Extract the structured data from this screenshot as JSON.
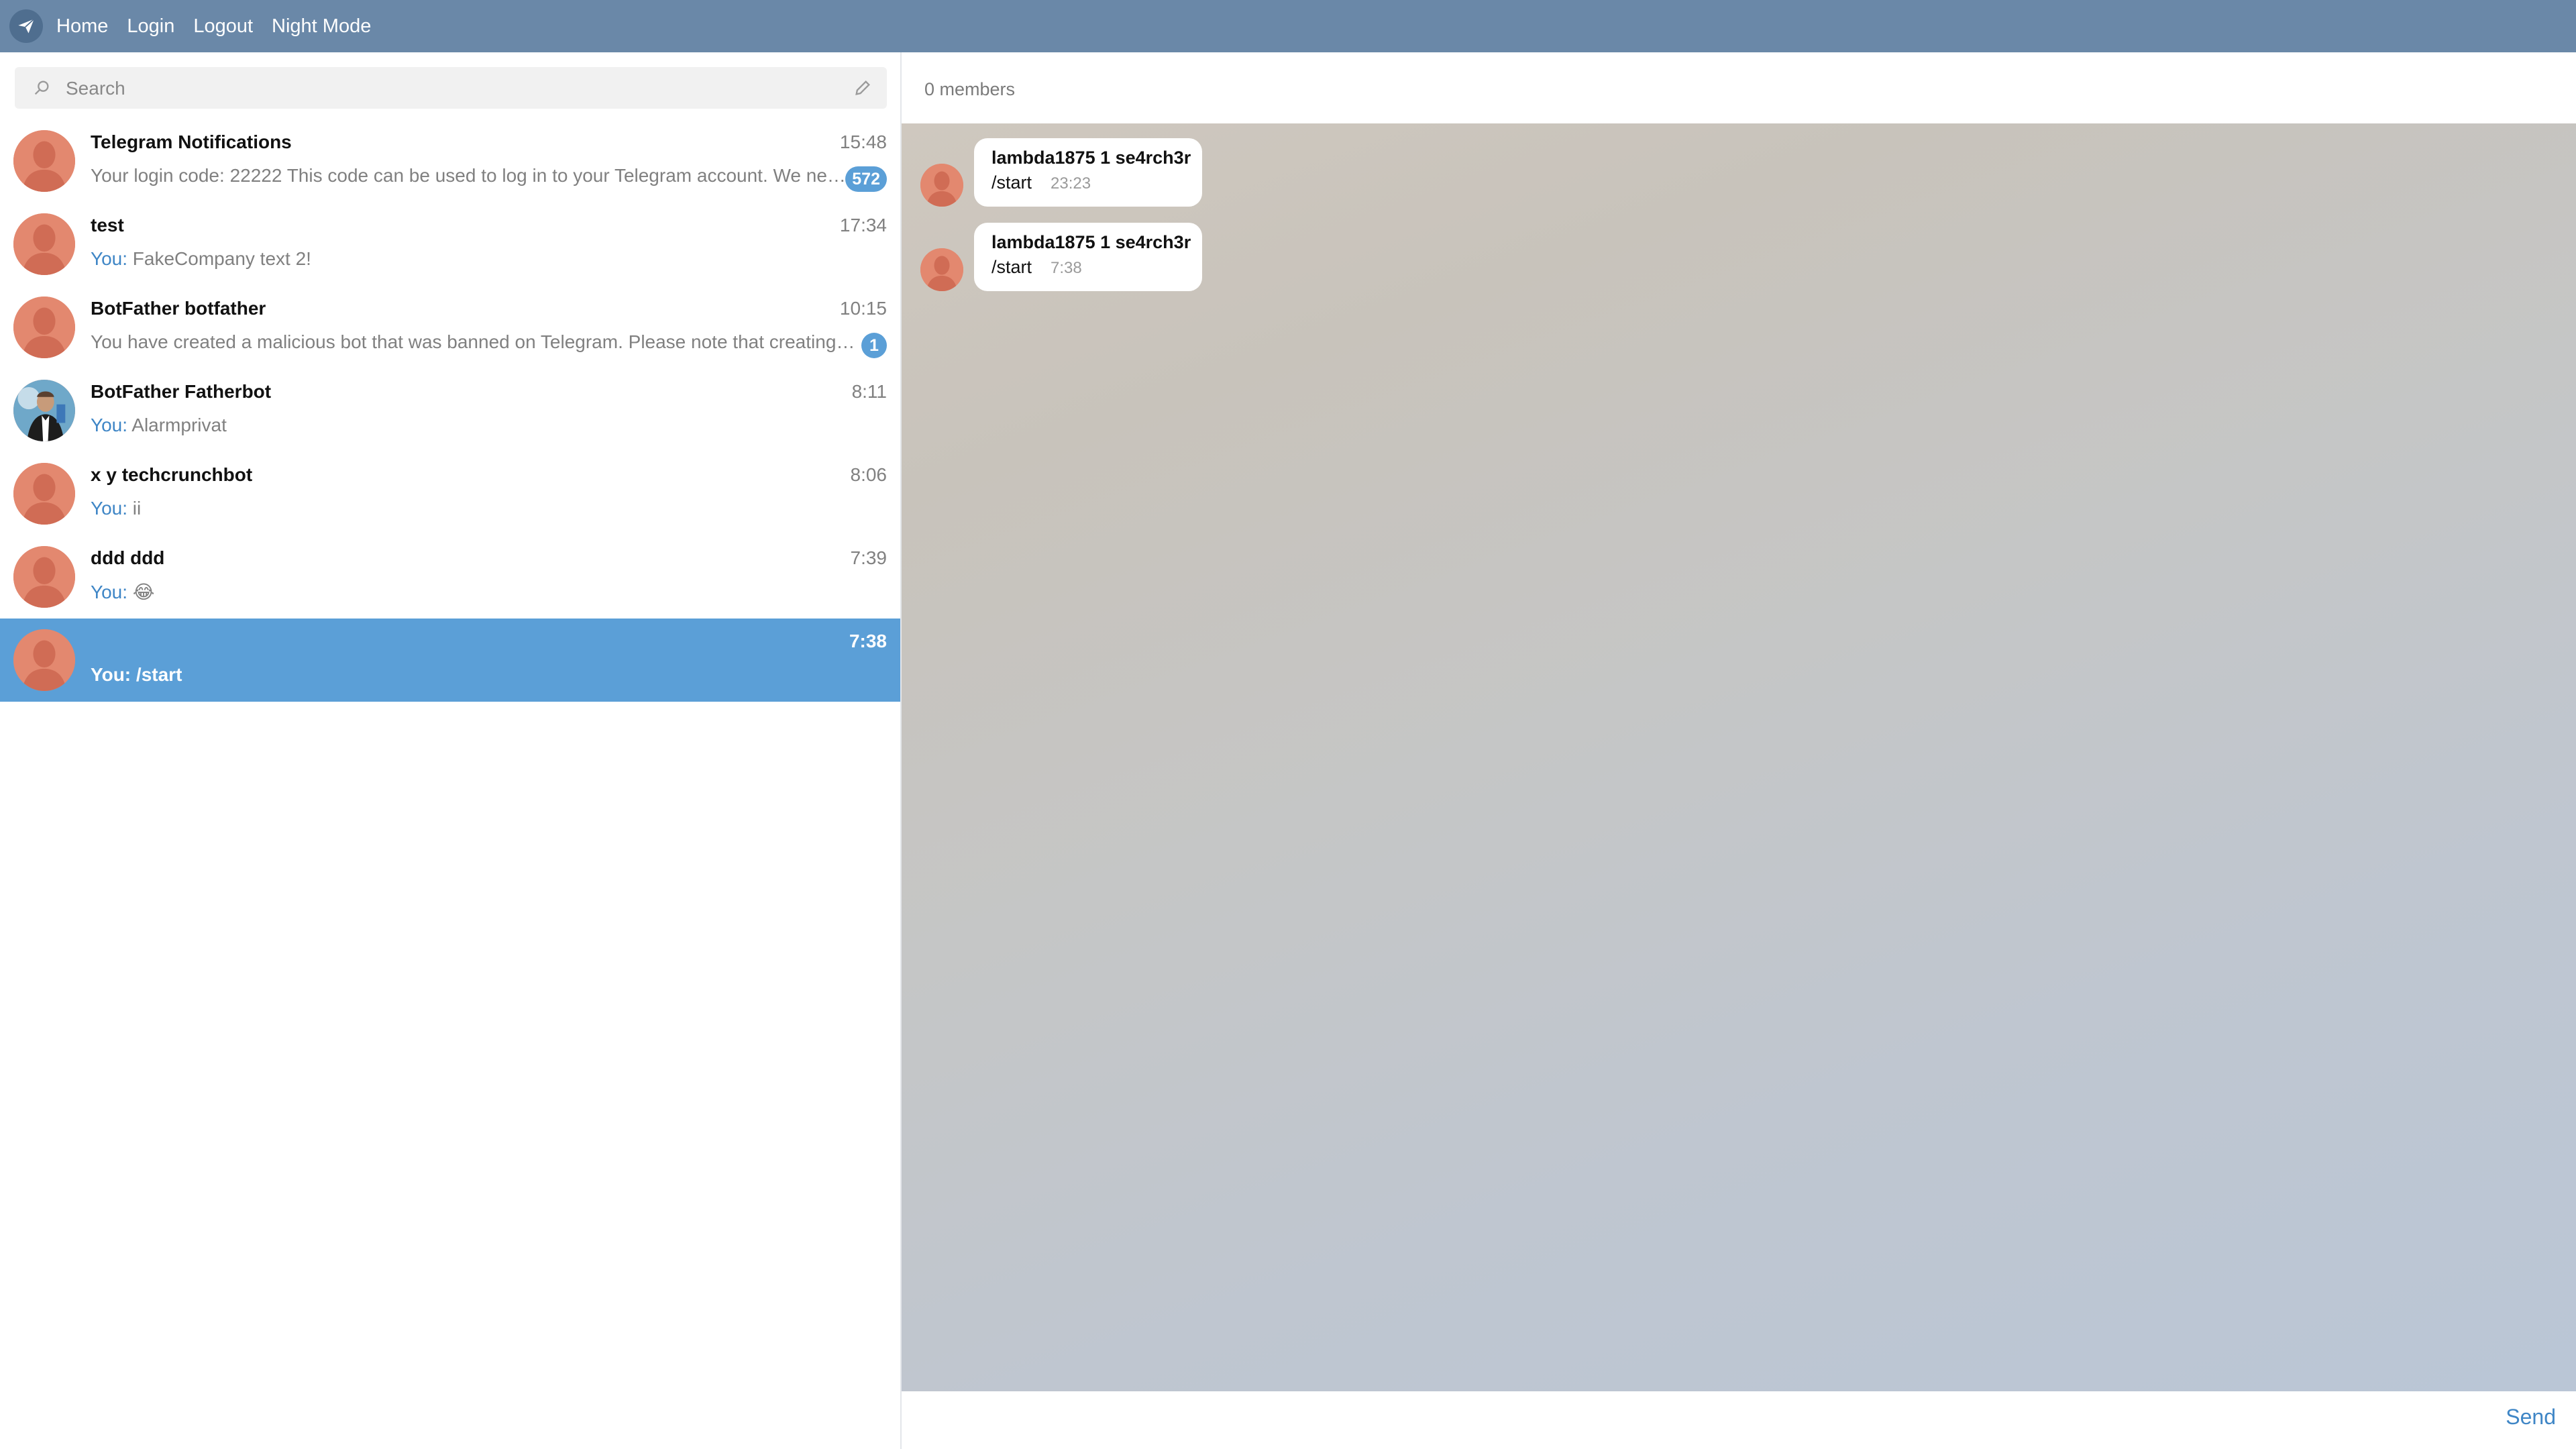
{
  "nav": {
    "links": [
      "Home",
      "Login",
      "Logout",
      "Night Mode"
    ]
  },
  "search": {
    "placeholder": "Search"
  },
  "chats": [
    {
      "name": "Telegram Notifications",
      "time": "15:48",
      "you": "",
      "preview": "Your login code: 22222 This code can be used to log in to your Telegram account. We never ask it for anything else. If you didn't request this code by trying to log in on another device, simply ignore this message.",
      "badge": "572",
      "avatar": "default-avatar"
    },
    {
      "name": "test",
      "time": "17:34",
      "you": "You:",
      "preview": " FakeCompany text 2!",
      "badge": "",
      "avatar": "default-avatar"
    },
    {
      "name": "BotFather botfather",
      "time": "10:15",
      "you": "",
      "preview": "You have created a malicious bot that was banned on Telegram. Please note that creating abusive bots violates our terms.",
      "badge": "1",
      "avatar": "default-avatar"
    },
    {
      "name": "BotFather Fatherbot",
      "time": "8:11",
      "you": "You:",
      "preview": " Alarmprivat",
      "badge": "",
      "avatar": "photo-avatar"
    },
    {
      "name": "x y techcrunchbot",
      "time": "8:06",
      "you": "You:",
      "preview": " ii",
      "badge": "",
      "avatar": "default-avatar"
    },
    {
      "name": "ddd ddd",
      "time": "7:39",
      "you": "You:",
      "preview": " 😂",
      "badge": "",
      "avatar": "default-avatar"
    },
    {
      "name": "",
      "time": "7:38",
      "you": "You:",
      "preview": " /start",
      "badge": "",
      "avatar": "default-avatar",
      "selected": true
    }
  ],
  "header": {
    "members": "0 members"
  },
  "messages": [
    {
      "author": "lambda1875 1 se4rch3r",
      "text": "/start",
      "time": "23:23"
    },
    {
      "author": "lambda1875 1 se4rch3r",
      "text": "/start",
      "time": "7:38"
    }
  ],
  "composer": {
    "send_label": "Send"
  },
  "colors": {
    "topbar": "#6a88a8",
    "accent": "#5b9fd7",
    "avatar": "#e3886f"
  }
}
